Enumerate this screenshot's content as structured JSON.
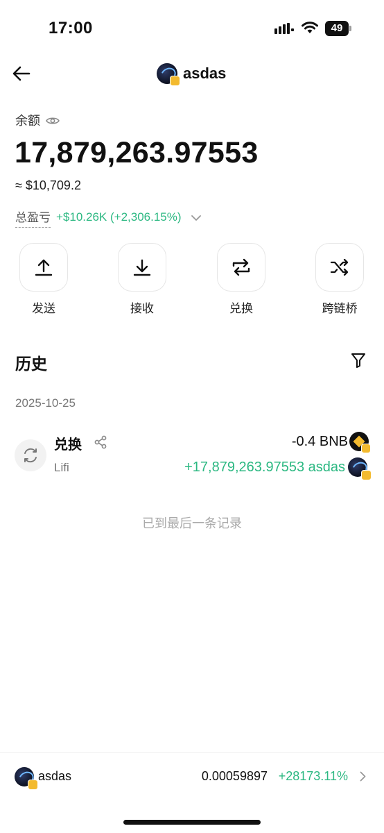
{
  "status_bar": {
    "time": "17:00",
    "battery": "49"
  },
  "nav": {
    "title": "asdas"
  },
  "balance": {
    "label": "余额",
    "amount": "17,879,263.97553",
    "usd_value": "≈ $10,709.2",
    "pnl_label": "总盈亏",
    "pnl_value": "+$10.26K (+2,306.15%)"
  },
  "actions": [
    {
      "label": "发送",
      "icon": "upload-arrow-icon"
    },
    {
      "label": "接收",
      "icon": "download-arrow-icon"
    },
    {
      "label": "兑换",
      "icon": "swap-icon"
    },
    {
      "label": "跨链桥",
      "icon": "shuffle-icon"
    }
  ],
  "history": {
    "title": "历史",
    "date": "2025-10-25",
    "transactions": [
      {
        "type": "兑换",
        "provider": "Lifi",
        "out": "-0.4 BNB",
        "in": "+17,879,263.97553 asdas"
      }
    ],
    "end_text": "已到最后一条记录"
  },
  "footer": {
    "token": "asdas",
    "price": "0.00059897",
    "change": "+28173.11%"
  },
  "colors": {
    "positive": "#2cb882",
    "bnb": "#f3ba2f",
    "text": "#111111"
  }
}
